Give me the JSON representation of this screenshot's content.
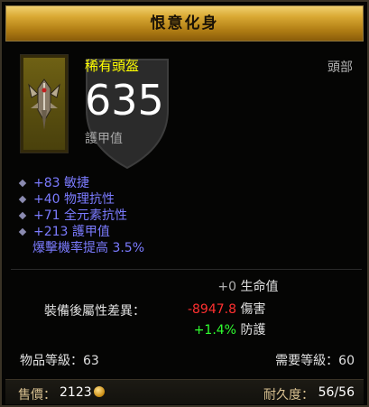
{
  "title": "恨意化身",
  "item": {
    "name": "稀有頭盔",
    "slot": "頭部",
    "armor_value": "635",
    "armor_label": "護甲值",
    "icon": "helm-icon"
  },
  "affixes": [
    {
      "text": "+83 敏捷",
      "bullet": true
    },
    {
      "text": "+40 物理抗性",
      "bullet": true
    },
    {
      "text": "+71 全元素抗性",
      "bullet": true
    },
    {
      "text": "+213 護甲值",
      "bullet": true
    },
    {
      "text": "爆擊機率提高 3.5%",
      "bullet": false
    }
  ],
  "comparison": {
    "label": "裝備後屬性差異：",
    "rows": [
      {
        "value": "+0",
        "stat": "生命值",
        "color": "#b0b0b0"
      },
      {
        "value": "-8947.8",
        "stat": "傷害",
        "color": "#ff3030"
      },
      {
        "value": "+1.4%",
        "stat": "防護",
        "color": "#30ff30"
      }
    ]
  },
  "item_level": {
    "label": "物品等級：",
    "value": "63"
  },
  "required_level": {
    "label": "需要等級：",
    "value": "60"
  },
  "price": {
    "label": "售價：",
    "value": "2123",
    "icon": "gold-coin-icon"
  },
  "durability": {
    "label": "耐久度：",
    "value": "56/56"
  },
  "colors": {
    "title_gold": "#d9a933",
    "rare_yellow": "#ffff00",
    "affix_blue": "#7b7bff",
    "negative_red": "#ff3030",
    "positive_green": "#30ff30"
  }
}
